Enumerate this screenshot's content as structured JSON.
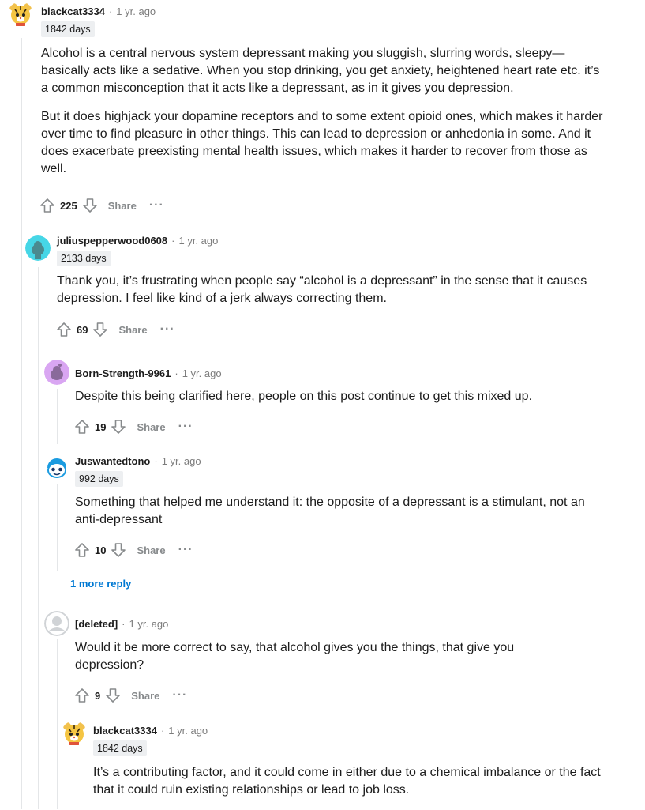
{
  "comments": [
    {
      "author": "blackcat3334",
      "sep": "·",
      "time": "1 yr. ago",
      "flair": "1842 days",
      "paragraphs": [
        "Alcohol is a central nervous system depressant making you sluggish, slurring words, sleepy—basically acts like a sedative. When you stop drinking, you get anxiety, heightened heart rate etc. it’s a common misconception that it acts like a depressant, as in it gives you depression.",
        "But it does highjack your dopamine receptors and to some extent opioid ones, which makes it harder over time to find pleasure in other things. This can lead to depression or anhedonia in some. And it does exacerbate preexisting mental health issues, which makes it harder to recover from those as well."
      ],
      "score": "225",
      "share": "Share",
      "more": "···",
      "avatar_icon": "tiger-avatar-icon"
    },
    {
      "author": "juliuspepperwood0608",
      "sep": "·",
      "time": "1 yr. ago",
      "flair": "2133 days",
      "paragraphs": [
        "Thank you, it’s frustrating when people say “alcohol is a depressant” in the sense that it causes depression. I feel like kind of a jerk always correcting them."
      ],
      "score": "69",
      "share": "Share",
      "more": "···",
      "avatar_icon": "snoo-teal-avatar-icon"
    },
    {
      "author": "Born-Strength-9961",
      "sep": "·",
      "time": "1 yr. ago",
      "paragraphs": [
        "Despite this being clarified here, people on this post continue to get this mixed up."
      ],
      "score": "19",
      "share": "Share",
      "more": "···",
      "avatar_icon": "snoo-purple-avatar-icon"
    },
    {
      "author": "Juswantedtono",
      "sep": "·",
      "time": "1 yr. ago",
      "flair": "992 days",
      "paragraphs": [
        "Something that helped me understand it: the opposite of a depressant is a stimulant, not an anti-depressant"
      ],
      "score": "10",
      "share": "Share",
      "more": "···",
      "avatar_icon": "snoo-blue-avatar-icon"
    },
    {
      "author": "[deleted]",
      "sep": "·",
      "time": "1 yr. ago",
      "paragraphs": [
        "Would it be more correct to say, that alcohol gives you the things, that give you depression?"
      ],
      "score": "9",
      "share": "Share",
      "more": "···",
      "avatar_icon": "deleted-user-avatar-icon"
    },
    {
      "author": "blackcat3334",
      "sep": "·",
      "time": "1 yr. ago",
      "flair": "1842 days",
      "paragraphs": [
        "It’s a contributing factor, and it could come in either due to a chemical imbalance or the fact that it could ruin existing relationships or lead to job loss."
      ],
      "avatar_icon": "tiger-avatar-icon"
    }
  ],
  "more_replies": "1 more reply",
  "colors": {
    "link": "#0079d3",
    "muted": "#7c7c7c",
    "flair_bg": "#edeff1",
    "thread_line": "#e4e6e8"
  }
}
